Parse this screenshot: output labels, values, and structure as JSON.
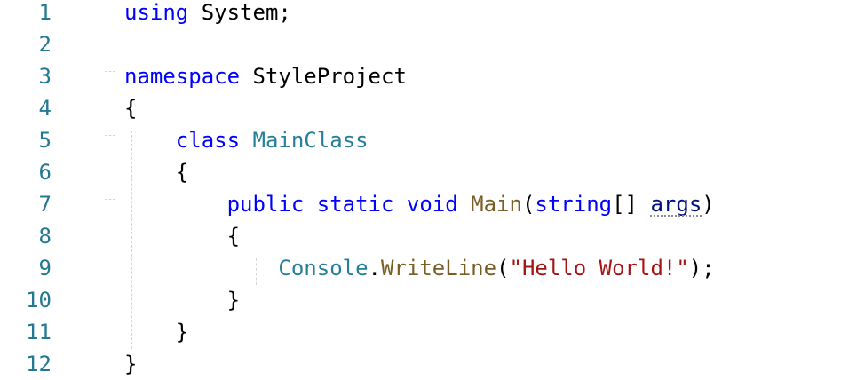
{
  "editor": {
    "line_numbers": [
      "1",
      "2",
      "3",
      "4",
      "5",
      "6",
      "7",
      "8",
      "9",
      "10",
      "11",
      "12"
    ],
    "lines": [
      {
        "tokens": [
          {
            "t": "kw",
            "v": "using"
          },
          {
            "t": "plain",
            "v": " System;"
          }
        ]
      },
      {
        "tokens": []
      },
      {
        "tokens": [
          {
            "t": "kw",
            "v": "namespace"
          },
          {
            "t": "plain",
            "v": " StyleProject"
          }
        ]
      },
      {
        "tokens": [
          {
            "t": "plain",
            "v": "{"
          }
        ]
      },
      {
        "tokens": [
          {
            "t": "plain",
            "v": "    "
          },
          {
            "t": "kw",
            "v": "class"
          },
          {
            "t": "plain",
            "v": " "
          },
          {
            "t": "type",
            "v": "MainClass"
          }
        ]
      },
      {
        "tokens": [
          {
            "t": "plain",
            "v": "    {"
          }
        ]
      },
      {
        "tokens": [
          {
            "t": "plain",
            "v": "        "
          },
          {
            "t": "kw",
            "v": "public"
          },
          {
            "t": "plain",
            "v": " "
          },
          {
            "t": "kw",
            "v": "static"
          },
          {
            "t": "plain",
            "v": " "
          },
          {
            "t": "kw",
            "v": "void"
          },
          {
            "t": "plain",
            "v": " "
          },
          {
            "t": "fn",
            "v": "Main"
          },
          {
            "t": "plain",
            "v": "("
          },
          {
            "t": "kw",
            "v": "string"
          },
          {
            "t": "plain",
            "v": "[] "
          },
          {
            "t": "param",
            "v": "args"
          },
          {
            "t": "plain",
            "v": ")"
          }
        ]
      },
      {
        "tokens": [
          {
            "t": "plain",
            "v": "        {"
          }
        ]
      },
      {
        "tokens": [
          {
            "t": "plain",
            "v": "            "
          },
          {
            "t": "type",
            "v": "Console"
          },
          {
            "t": "plain",
            "v": "."
          },
          {
            "t": "fn",
            "v": "WriteLine"
          },
          {
            "t": "plain",
            "v": "("
          },
          {
            "t": "str",
            "v": "\"Hello World!\""
          },
          {
            "t": "plain",
            "v": ");"
          }
        ]
      },
      {
        "tokens": [
          {
            "t": "plain",
            "v": "        }"
          }
        ]
      },
      {
        "tokens": [
          {
            "t": "plain",
            "v": "    }"
          }
        ]
      },
      {
        "tokens": [
          {
            "t": "plain",
            "v": "}"
          }
        ]
      }
    ],
    "colors": {
      "keyword": "#0000ff",
      "type": "#267f99",
      "function": "#795e26",
      "string": "#a31515",
      "parameter": "#001080",
      "line_number": "#237893"
    }
  }
}
